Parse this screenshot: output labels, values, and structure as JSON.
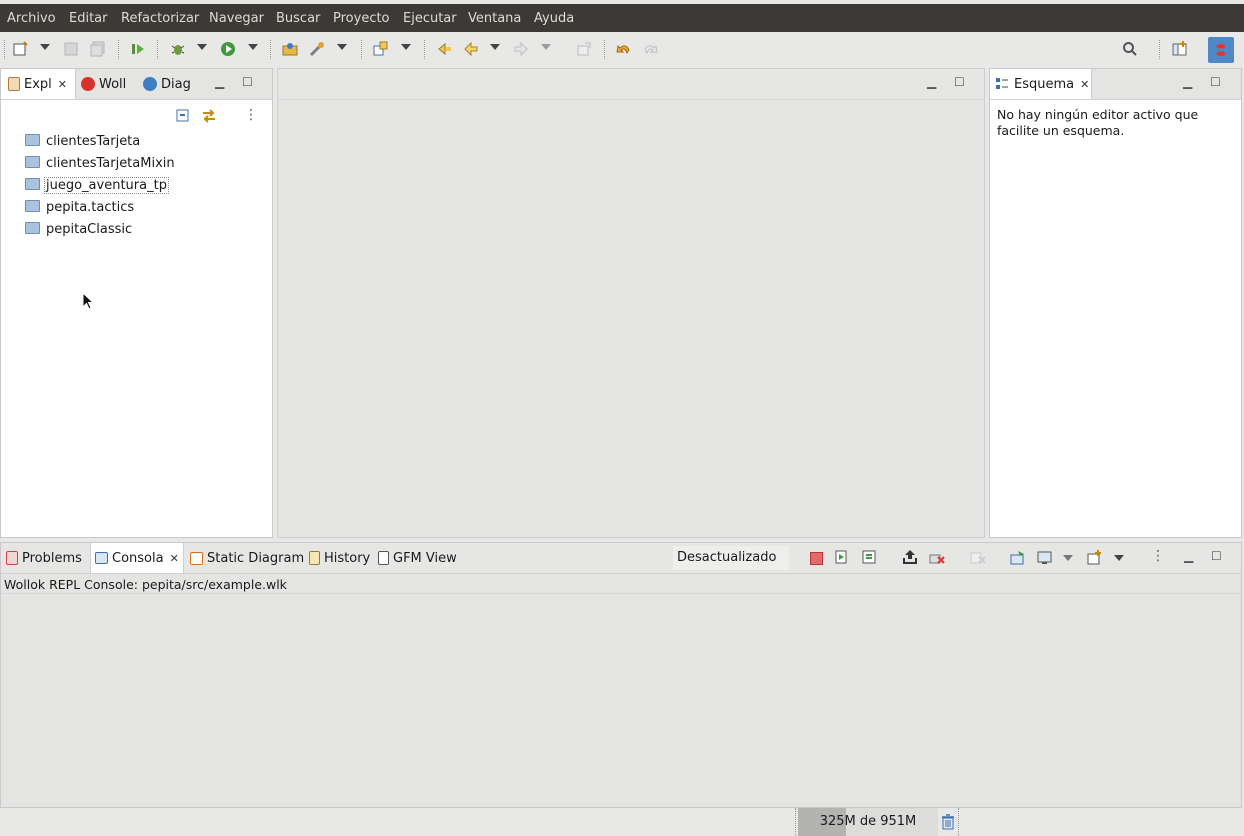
{
  "menu": {
    "items": [
      "Archivo",
      "Editar",
      "Refactorizar",
      "Navegar",
      "Buscar",
      "Proyecto",
      "Ejecutar",
      "Ventana",
      "Ayuda"
    ]
  },
  "toolbar": {
    "icons": [
      "new-wizard-icon",
      "save-icon",
      "save-all-icon",
      "run-last-icon",
      "debug-icon",
      "run-icon",
      "open-project-icon",
      "tools-icon",
      "new-element-icon",
      "back-history-icon",
      "back-icon",
      "forward-icon",
      "pin-icon",
      "undo-icon",
      "redo-icon",
      "search-icon",
      "open-perspective-icon",
      "wollok-perspective-icon"
    ]
  },
  "explorer": {
    "tabs": [
      {
        "label": "Expl",
        "icon": "project-explorer-icon"
      },
      {
        "label": "Woll",
        "icon": "wollok-icon"
      },
      {
        "label": "Diag",
        "icon": "diagram-icon"
      }
    ],
    "items": [
      "clientesTarjeta",
      "clientesTarjetaMixin",
      "juego_aventura_tp",
      "pepita.tactics",
      "pepitaClassic"
    ],
    "selected_index": 2
  },
  "outline": {
    "tab_label": "Esquema",
    "message": "No hay ningún editor activo que facilite un esquema."
  },
  "console": {
    "tabs": [
      {
        "label": "Problems",
        "icon": "problems-icon"
      },
      {
        "label": "Consola",
        "icon": "console-icon"
      },
      {
        "label": "Static Diagram",
        "icon": "static-diagram-icon"
      },
      {
        "label": "History",
        "icon": "history-icon"
      },
      {
        "label": "GFM View",
        "icon": "gfm-view-icon"
      }
    ],
    "status_field": "Desactualizado",
    "title": "Wollok REPL Console: pepita/src/example.wlk"
  },
  "status": {
    "memory": "325M de 951M",
    "memory_used_fraction": 0.342
  },
  "colors": {
    "menubar_bg": "#3b3a36",
    "panel_bg": "#ffffff",
    "editor_bg": "#e4e4e3"
  }
}
